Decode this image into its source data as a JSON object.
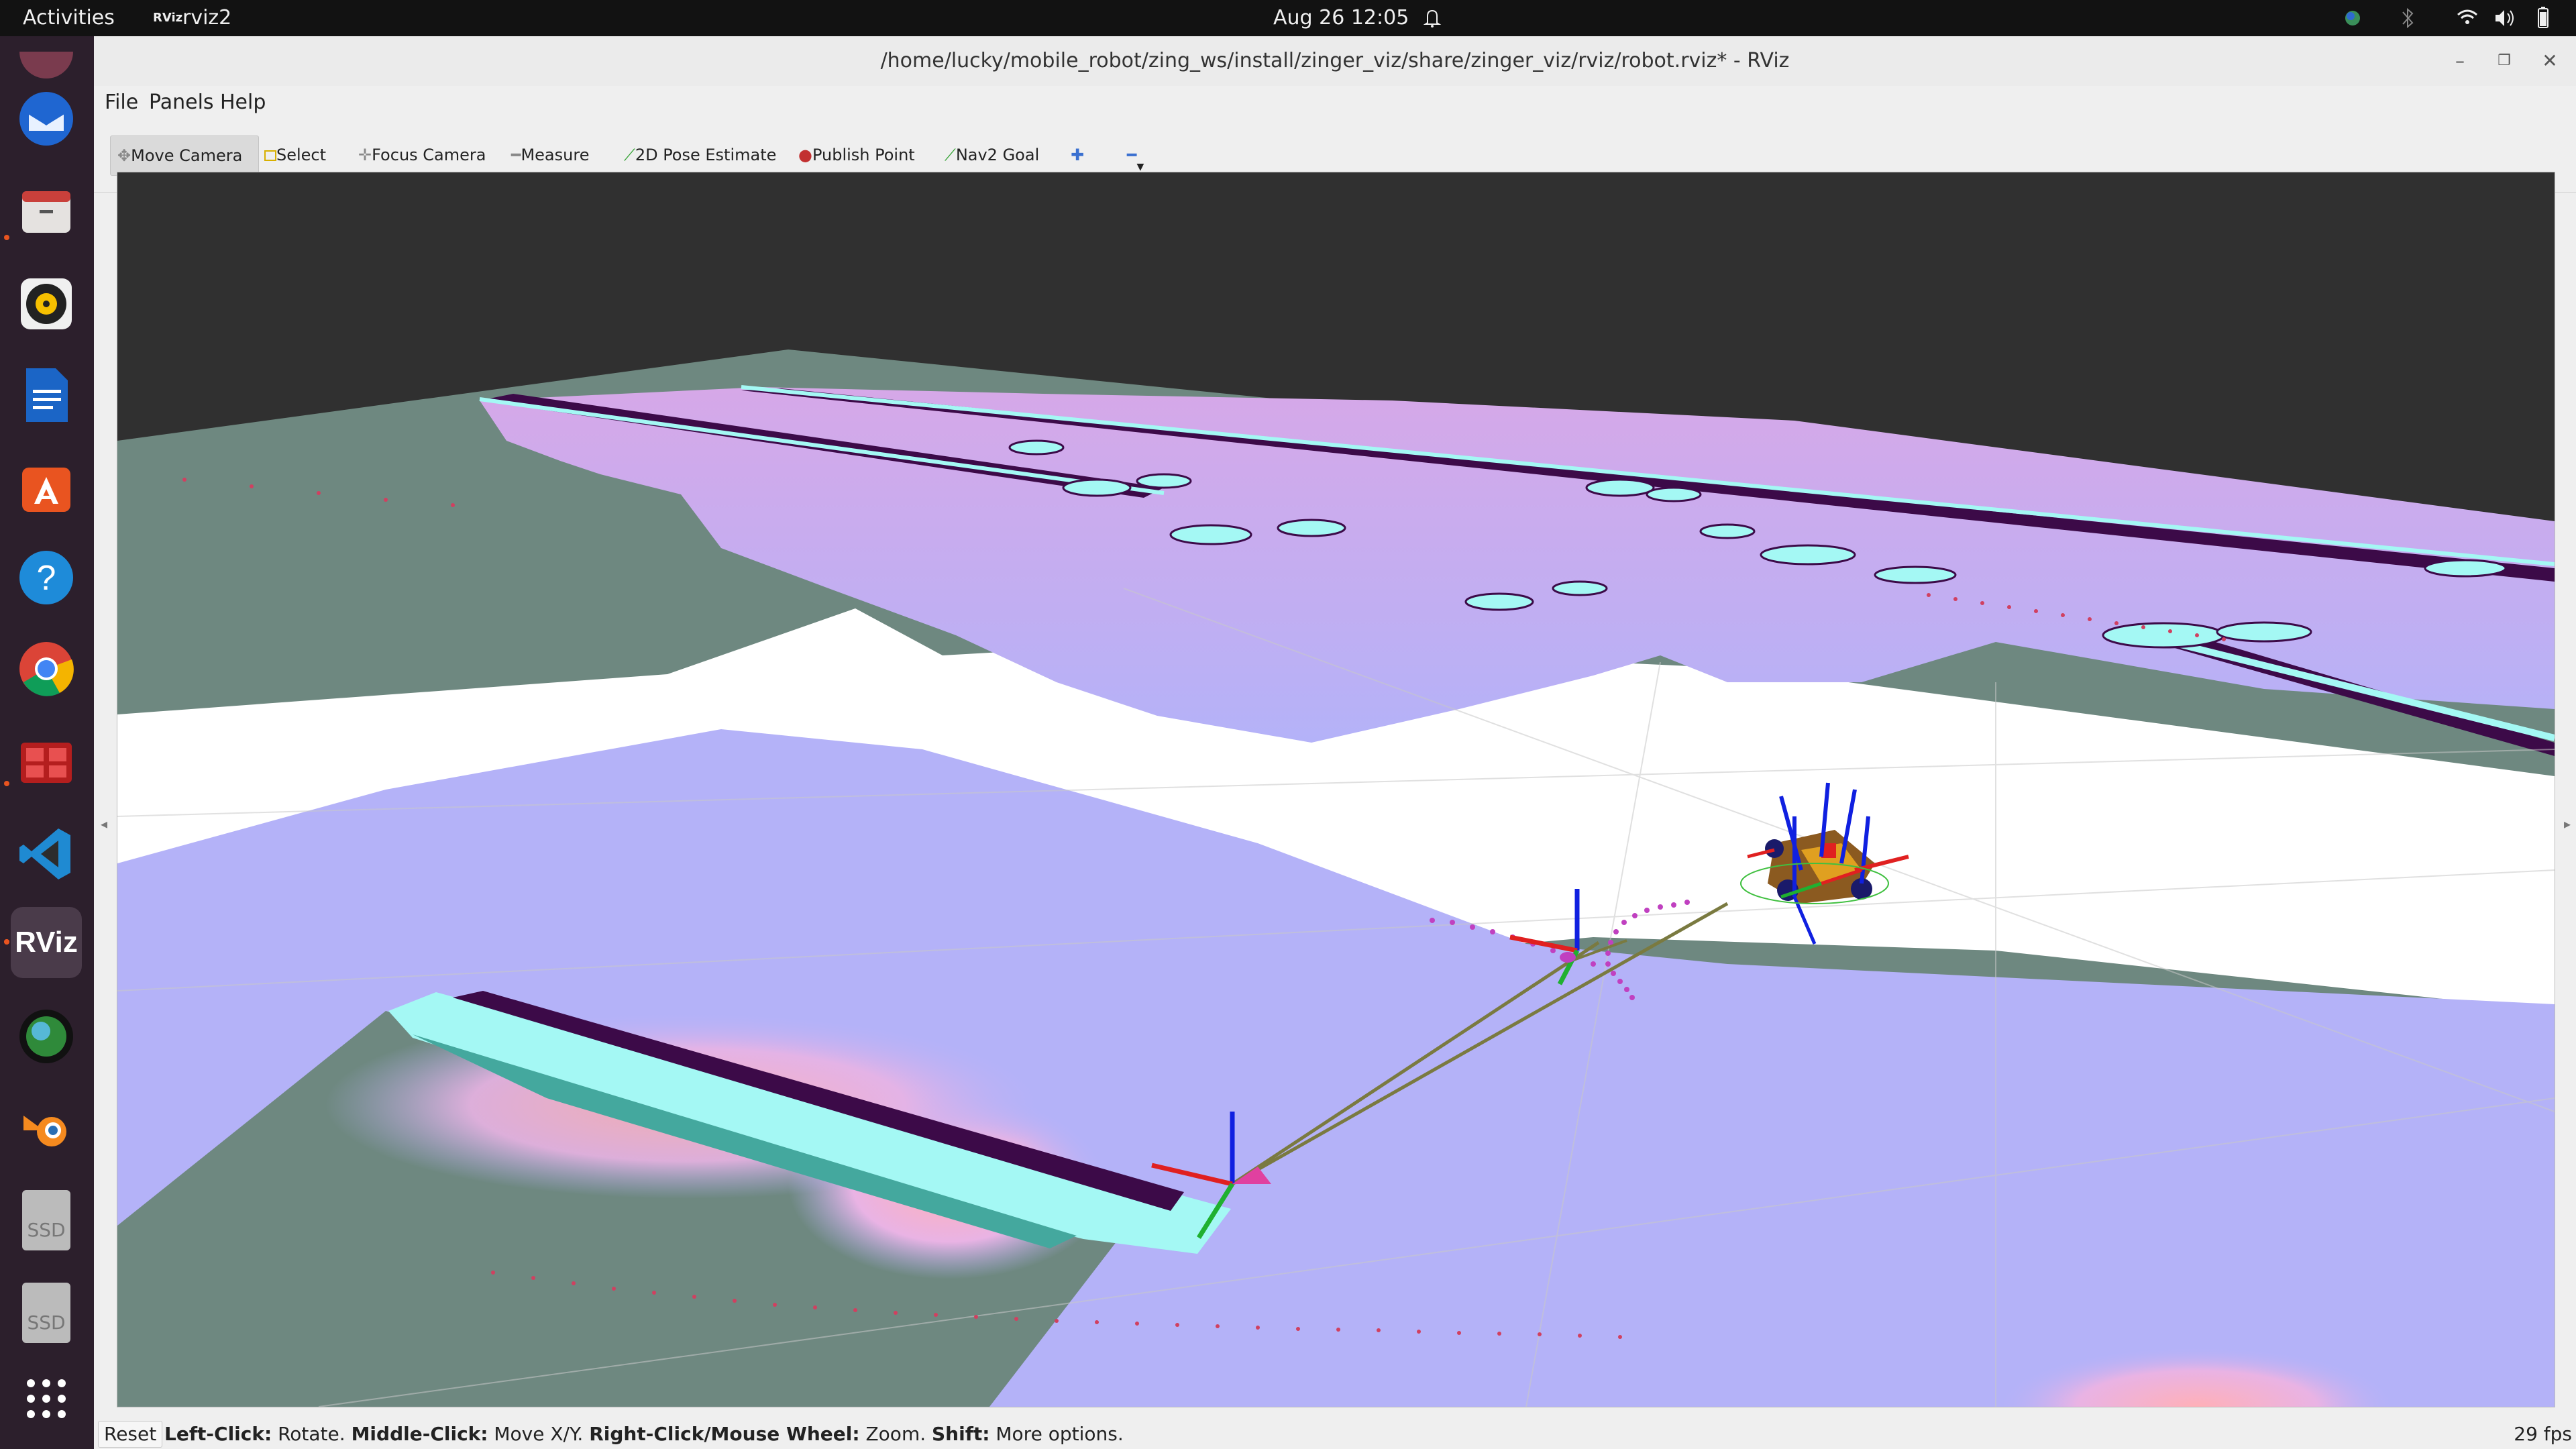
{
  "topbar": {
    "activities": "Activities",
    "app_name": "rviz2",
    "app_icon_text": "RViz",
    "datetime": "Aug 26  12:05"
  },
  "dock": {
    "items": [
      {
        "name": "thunderbird-icon"
      },
      {
        "name": "files-icon"
      },
      {
        "name": "rhythmbox-icon"
      },
      {
        "name": "writer-icon"
      },
      {
        "name": "app-center-icon"
      },
      {
        "name": "help-icon"
      },
      {
        "name": "chrome-icon"
      },
      {
        "name": "red-app-icon"
      },
      {
        "name": "vscode-icon"
      },
      {
        "name": "rviz-icon",
        "label": "RViz"
      },
      {
        "name": "globe-icon"
      },
      {
        "name": "blender-icon"
      },
      {
        "name": "ssd-drive-icon",
        "label": "SSD"
      },
      {
        "name": "ssd-drive-icon",
        "label": "SSD"
      },
      {
        "name": "show-apps-icon"
      }
    ]
  },
  "window": {
    "title": "/home/lucky/mobile_robot/zing_ws/install/zinger_viz/share/zinger_viz/rviz/robot.rviz* - RViz"
  },
  "menu": [
    "File",
    "Panels",
    "Help"
  ],
  "toolbar": [
    {
      "label": "Move Camera",
      "icon": "move-camera-icon",
      "active": true
    },
    {
      "label": "Select",
      "icon": "select-icon"
    },
    {
      "label": "Focus Camera",
      "icon": "focus-camera-icon"
    },
    {
      "label": "Measure",
      "icon": "measure-icon"
    },
    {
      "label": "2D Pose Estimate",
      "icon": "pose-estimate-icon"
    },
    {
      "label": "Publish Point",
      "icon": "publish-point-icon"
    },
    {
      "label": "Nav2 Goal",
      "icon": "nav2-goal-icon"
    }
  ],
  "status": {
    "reset": "Reset",
    "hint": [
      {
        "b": "Left-Click:",
        "t": " Rotate. "
      },
      {
        "b": "Middle-Click:",
        "t": " Move X/Y. "
      },
      {
        "b": "Right-Click/Mouse Wheel:",
        "t": " Zoom. "
      },
      {
        "b": "Shift:",
        "t": " More options."
      }
    ],
    "fps": "29 fps"
  },
  "colors": {
    "costmap_lavender": "#b4b2f8",
    "inflation_pink": "#ffa8b8",
    "lethal_cyan": "#a4f8f4",
    "obstacle_purple": "#3c0a48",
    "unknown_gray": "#6e8880",
    "free_white": "#ffffff",
    "background": "#303030",
    "path_magenta": "#c040c0"
  }
}
